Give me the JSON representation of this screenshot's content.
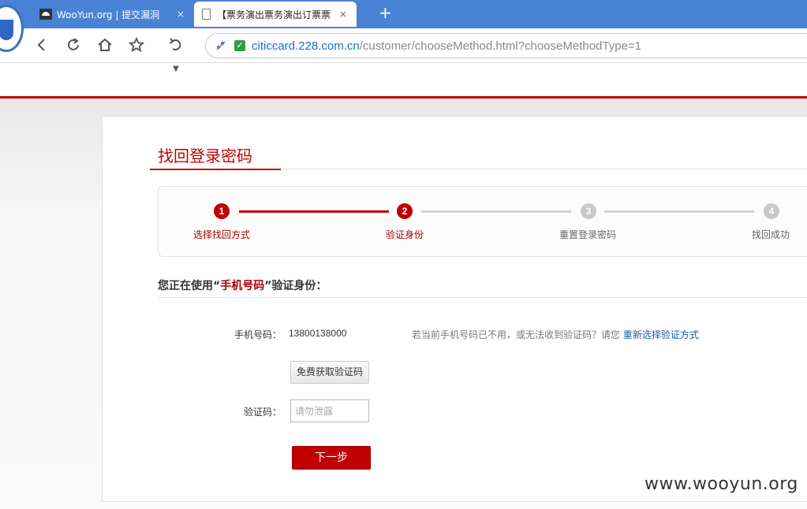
{
  "browser": {
    "tabs": [
      {
        "title": "WooYun.org | 提交漏洞",
        "close": "×"
      },
      {
        "title": "【票务演出票务演出订票票",
        "close": "×"
      }
    ],
    "new_tab": "+",
    "address": {
      "host": "citiccard.228.com.cn",
      "path": "/customer/chooseMethod.html?chooseMethodType=1"
    }
  },
  "page": {
    "title": "找回登录密码",
    "steps": [
      {
        "num": "1",
        "label": "选择找回方式",
        "state": "active"
      },
      {
        "num": "2",
        "label": "验证身份",
        "state": "active"
      },
      {
        "num": "3",
        "label": "重置登录密码",
        "state": "inactive"
      },
      {
        "num": "4",
        "label": "找回成功",
        "state": "inactive"
      }
    ],
    "verify_heading": {
      "prefix": "您正在使用“",
      "method": "手机号码",
      "suffix": "”验证身份："
    },
    "phone": {
      "label": "手机号码：",
      "value": "13800138000"
    },
    "hint": {
      "text": "若当前手机号码已不用，或无法收到验证码？请您 ",
      "link": "重新选择验证方式"
    },
    "sms_button": "免费获取验证码",
    "code": {
      "label": "验证码：",
      "placeholder": "请勿泄露"
    },
    "next_button": "下一步"
  },
  "watermark": "www.wooyun.org",
  "colors": {
    "accent": "#c00000",
    "link": "#1a5da6",
    "tabbar": "#4a82d6"
  }
}
